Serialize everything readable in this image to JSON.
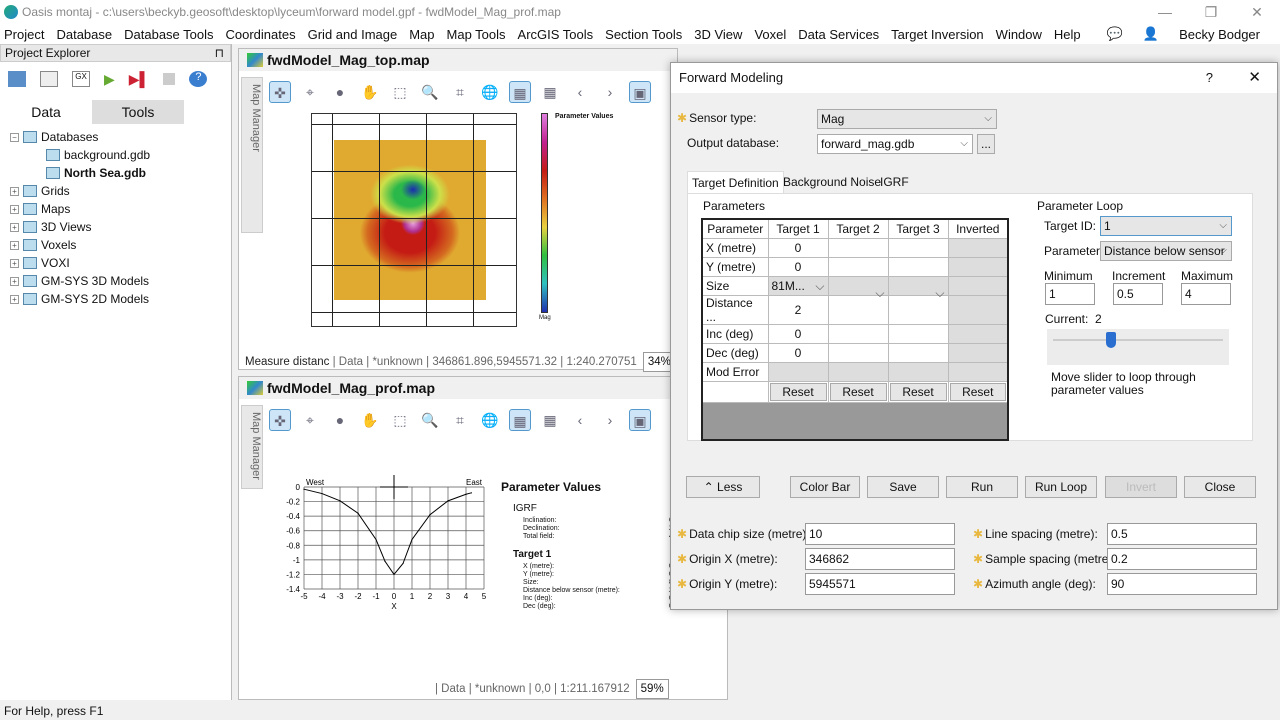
{
  "app": {
    "title": "Oasis montaj - c:\\users\\beckyb.geosoft\\desktop\\lyceum\\forward model.gpf - fwdModel_Mag_prof.map",
    "user": "Becky Bodger",
    "status": "For Help, press F1"
  },
  "menu": [
    "Project",
    "Database",
    "Database Tools",
    "Coordinates",
    "Grid and Image",
    "Map",
    "Map Tools",
    "ArcGIS Tools",
    "Section Tools",
    "3D View",
    "Voxel",
    "Data Services",
    "Target Inversion",
    "Window",
    "Help"
  ],
  "explorer": {
    "title": "Project Explorer",
    "tabs": [
      "Data",
      "Tools"
    ],
    "tree": [
      {
        "label": "Databases",
        "level": 0
      },
      {
        "label": "background.gdb",
        "level": 1
      },
      {
        "label": "North Sea.gdb",
        "level": 1,
        "bold": true
      },
      {
        "label": "Grids",
        "level": 0
      },
      {
        "label": "Maps",
        "level": 0
      },
      {
        "label": "3D Views",
        "level": 0
      },
      {
        "label": "Voxels",
        "level": 0
      },
      {
        "label": "VOXI",
        "level": 0
      },
      {
        "label": "GM-SYS 3D Models",
        "level": 0
      },
      {
        "label": "GM-SYS 2D Models",
        "level": 0
      }
    ]
  },
  "map_top": {
    "title": "fwdModel_Mag_top.map",
    "side": "Map Manager",
    "status": {
      "tool": "Measure distanc",
      "db": "| Data",
      "proj": "| *unknown",
      "coords": "| 346861.896,5945571.32",
      "scale": "| 1:240.270751",
      "zoom": "34%"
    },
    "legend_title": "Parameter Values",
    "colorbar_label": "Mag"
  },
  "map_prof": {
    "title": "fwdModel_Mag_prof.map",
    "side": "Map Manager",
    "status": {
      "db": "| Data",
      "proj": "| *unknown",
      "coords": "| 0,0",
      "scale": "| 1:211.167912",
      "zoom": "59%"
    },
    "panel": {
      "title": "Parameter Values",
      "igrf_head": "IGRF",
      "igrf": [
        [
          "Inclination:",
          "68."
        ],
        [
          "Declination:",
          "2.3"
        ],
        [
          "Total field:",
          "49"
        ]
      ],
      "target_head": "Target 1",
      "target": [
        [
          "X (metre):",
          "0"
        ],
        [
          "Y (metre):",
          "0"
        ],
        [
          "Size:",
          "81"
        ],
        [
          "Distance below sensor (metre):",
          "2"
        ],
        [
          "Inc (deg):",
          "0"
        ],
        [
          "Dec (deg):",
          "0"
        ]
      ]
    }
  },
  "chart_data": {
    "type": "line",
    "xlabel": "X",
    "ylabel": "",
    "west_label": "West",
    "east_label": "East",
    "xlim": [
      -5,
      5
    ],
    "ylim": [
      -1.4,
      0
    ],
    "grid": true,
    "xticks": [
      "-5",
      "-4",
      "-3",
      "-2",
      "-1",
      "0",
      "1",
      "2",
      "3",
      "4",
      "5"
    ],
    "yticks": [
      "0",
      "-0.2",
      "-0.4",
      "-0.6",
      "-0.8",
      "-1",
      "-1.2",
      "-1.4"
    ],
    "x": [
      -5,
      -4,
      -3,
      -2,
      -1,
      -0.5,
      0,
      0.5,
      1,
      2,
      3,
      4,
      4.3
    ],
    "y": [
      -0.03,
      -0.09,
      -0.19,
      -0.36,
      -0.72,
      -1.02,
      -1.2,
      -1.05,
      -0.72,
      -0.38,
      -0.19,
      -0.1,
      -0.08
    ]
  },
  "dialog": {
    "title": "Forward Modeling",
    "help": "?",
    "sensor_label": "Sensor type:",
    "sensor": "Mag",
    "output_label": "Output database:",
    "output": "forward_mag.gdb",
    "browse": "...",
    "tabs": [
      "Target Definition",
      "Background Noise",
      "IGRF"
    ],
    "params_title": "Parameters",
    "headers": [
      "Parameter",
      "Target 1",
      "Target 2",
      "Target 3",
      "Inverted"
    ],
    "rows": [
      [
        "X (metre)",
        "0"
      ],
      [
        "Y (metre)",
        "0"
      ],
      [
        "Size",
        "81M..."
      ],
      [
        "Distance ...",
        "2"
      ],
      [
        "Inc (deg)",
        "0"
      ],
      [
        "Dec (deg)",
        "0"
      ],
      [
        "Mod Error",
        ""
      ]
    ],
    "reset": "Reset",
    "loop": {
      "title": "Parameter Loop",
      "target_label": "Target ID:",
      "target": "1",
      "param_label": "Parameter:",
      "param": "Distance below sensor",
      "min_label": "Minimum",
      "min": "1",
      "inc_label": "Increment",
      "inc": "0.5",
      "max_label": "Maximum",
      "max": "4",
      "current_label": "Current:",
      "current": "2",
      "hint": "Move slider to loop through parameter values"
    },
    "buttons": {
      "less": "⌃ Less",
      "colorbar": "Color Bar",
      "save": "Save",
      "run": "Run",
      "runloop": "Run Loop",
      "invert": "Invert",
      "close": "Close"
    },
    "fields": {
      "chip_label": "Data chip size (metre):",
      "chip": "10",
      "ox_label": "Origin X (metre):",
      "ox": "346862",
      "oy_label": "Origin Y (metre):",
      "oy": "5945571",
      "line_label": "Line spacing (metre):",
      "line": "0.5",
      "sample_label": "Sample spacing (metre):",
      "sample": "0.2",
      "az_label": "Azimuth angle (deg):",
      "az": "90"
    }
  }
}
